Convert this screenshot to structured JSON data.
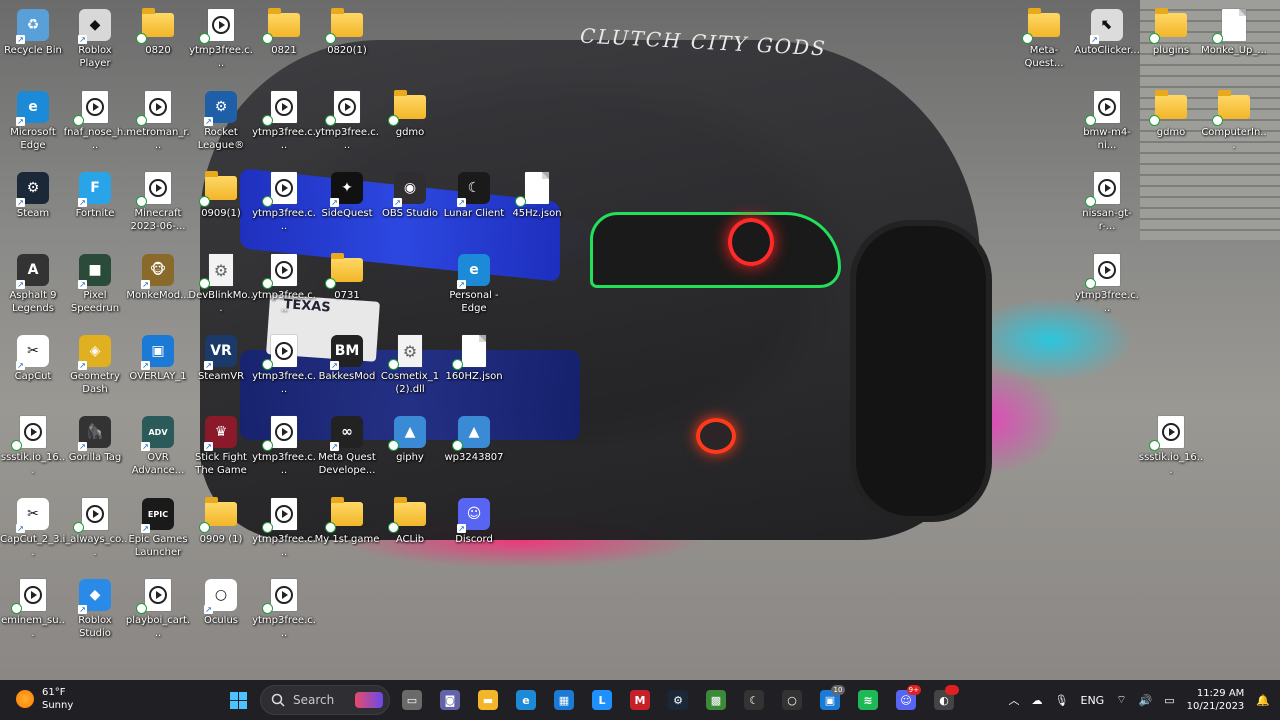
{
  "wallpaper": {
    "windshield_text": "CLUTCH CITY GODS",
    "plate_text": "TEXAS"
  },
  "desktop_icons": [
    {
      "id": "recycle-bin",
      "label": "Recycle Bin",
      "kind": "app",
      "icon": "recycle-bin-icon",
      "color": "#5aa0d8",
      "glyph": "♻"
    },
    {
      "id": "roblox-player",
      "label": "Roblox Player",
      "kind": "app",
      "icon": "roblox-icon",
      "color": "#d8d8d8",
      "glyph": "◆"
    },
    {
      "id": "folder-0820",
      "label": "0820",
      "kind": "folder",
      "icon": "folder-icon"
    },
    {
      "id": "ytmp3-1",
      "label": "ytmp3free.c...",
      "kind": "video",
      "icon": "video-file-icon"
    },
    {
      "id": "folder-0821",
      "label": "0821",
      "kind": "folder",
      "icon": "folder-icon"
    },
    {
      "id": "folder-0820-1",
      "label": "0820(1)",
      "kind": "folder",
      "icon": "folder-icon"
    },
    {
      "id": "edge",
      "label": "Microsoft Edge",
      "kind": "app",
      "icon": "edge-icon",
      "color": "#1c8ad6",
      "glyph": "e"
    },
    {
      "id": "fnaf",
      "label": "fnaf_nose_h...",
      "kind": "video",
      "icon": "video-file-icon"
    },
    {
      "id": "metroman",
      "label": "metroman_r...",
      "kind": "video",
      "icon": "video-file-icon"
    },
    {
      "id": "rocket-league",
      "label": "Rocket League®",
      "kind": "app",
      "icon": "rocket-league-icon",
      "color": "#1e5fa8",
      "glyph": "⚙"
    },
    {
      "id": "ytmp3-2",
      "label": "ytmp3free.c...",
      "kind": "video",
      "icon": "video-file-icon"
    },
    {
      "id": "ytmp3-3",
      "label": "ytmp3free.c...",
      "kind": "video",
      "icon": "video-file-icon"
    },
    {
      "id": "gdmo-1",
      "label": "gdmo",
      "kind": "folder",
      "icon": "folder-icon"
    },
    {
      "id": "steam",
      "label": "Steam",
      "kind": "app",
      "icon": "steam-icon",
      "color": "#1b2838",
      "glyph": "⚙"
    },
    {
      "id": "fortnite",
      "label": "Fortnite",
      "kind": "app",
      "icon": "fortnite-icon",
      "color": "#2aa4e8",
      "glyph": "F"
    },
    {
      "id": "minecraft-video",
      "label": "Minecraft 2023-06-...",
      "kind": "video",
      "icon": "video-file-icon"
    },
    {
      "id": "folder-0909-1b",
      "label": "0909(1)",
      "kind": "folder",
      "icon": "folder-icon"
    },
    {
      "id": "ytmp3-4",
      "label": "ytmp3free.c...",
      "kind": "video",
      "icon": "video-file-icon"
    },
    {
      "id": "sidequest",
      "label": "SideQuest",
      "kind": "app",
      "icon": "sidequest-icon",
      "color": "#111111",
      "glyph": "✦"
    },
    {
      "id": "obs",
      "label": "OBS Studio",
      "kind": "app",
      "icon": "obs-icon",
      "color": "#302e31",
      "glyph": "◉"
    },
    {
      "id": "lunar",
      "label": "Lunar Client",
      "kind": "app",
      "icon": "lunar-client-icon",
      "color": "#1a1a1a",
      "glyph": "☾"
    },
    {
      "id": "45hz",
      "label": "45Hz.json",
      "kind": "file",
      "icon": "json-file-icon"
    },
    {
      "id": "asphalt",
      "label": "Asphalt 9 Legends",
      "kind": "app",
      "icon": "asphalt-icon",
      "color": "#333333",
      "glyph": "A"
    },
    {
      "id": "pixel-speedrun",
      "label": "Pixel Speedrun",
      "kind": "app",
      "icon": "pixel-speedrun-icon",
      "color": "#2a4a3a",
      "glyph": "■"
    },
    {
      "id": "monkemod",
      "label": "MonkeMod...",
      "kind": "app",
      "icon": "monkemod-icon",
      "color": "#8a6a2a",
      "glyph": "🐵"
    },
    {
      "id": "devblink",
      "label": "DevBlinkMo...",
      "kind": "dll",
      "icon": "settings-file-icon"
    },
    {
      "id": "ytmp3-5",
      "label": "ytmp3free.c...",
      "kind": "video",
      "icon": "video-file-icon"
    },
    {
      "id": "folder-0731",
      "label": "0731",
      "kind": "folder",
      "icon": "folder-icon"
    },
    {
      "id": "personal-edge",
      "label": "Personal - Edge",
      "kind": "app",
      "icon": "edge-icon",
      "color": "#1c8ad6",
      "glyph": "e"
    },
    {
      "id": "capcut",
      "label": "CapCut",
      "kind": "app",
      "icon": "capcut-icon",
      "color": "#ffffff",
      "glyph": "✂"
    },
    {
      "id": "geometry-dash",
      "label": "Geometry Dash",
      "kind": "app",
      "icon": "geometry-dash-icon",
      "color": "#e0b020",
      "glyph": "◈"
    },
    {
      "id": "overlay",
      "label": "OVERLAY_1",
      "kind": "app",
      "icon": "overlay-icon",
      "color": "#1a7ad6",
      "glyph": "▣"
    },
    {
      "id": "steamvr",
      "label": "SteamVR",
      "kind": "app",
      "icon": "steamvr-icon",
      "color": "#1b3a6a",
      "glyph": "VR"
    },
    {
      "id": "ytmp3-6",
      "label": "ytmp3free.c...",
      "kind": "video",
      "icon": "video-file-icon"
    },
    {
      "id": "bakkesmod",
      "label": "BakkesMod",
      "kind": "app",
      "icon": "bakkesmod-icon",
      "color": "#222222",
      "glyph": "BM"
    },
    {
      "id": "cosmetix",
      "label": "Cosmetix_1 (2).dll",
      "kind": "dll",
      "icon": "dll-file-icon"
    },
    {
      "id": "160hz",
      "label": "160HZ.json",
      "kind": "file",
      "icon": "json-file-icon"
    },
    {
      "id": "ssstik-1",
      "label": "ssstik.io_16...",
      "kind": "video",
      "icon": "video-file-icon"
    },
    {
      "id": "gorilla-tag",
      "label": "Gorilla Tag",
      "kind": "app",
      "icon": "gorilla-tag-icon",
      "color": "#333333",
      "glyph": "🦍"
    },
    {
      "id": "ovr-advanced",
      "label": "OVR Advance...",
      "kind": "app",
      "icon": "ovr-advanced-icon",
      "color": "#2a5a5a",
      "glyph": "ADV"
    },
    {
      "id": "stick-fight",
      "label": "Stick Fight The Game",
      "kind": "app",
      "icon": "stick-fight-icon",
      "color": "#8a1a2a",
      "glyph": "♛"
    },
    {
      "id": "ytmp3-7",
      "label": "ytmp3free.c...",
      "kind": "video",
      "icon": "video-file-icon"
    },
    {
      "id": "meta-dev",
      "label": "Meta Quest Develope...",
      "kind": "app",
      "icon": "meta-icon",
      "color": "#222222",
      "glyph": "∞"
    },
    {
      "id": "giphy",
      "label": "giphy",
      "kind": "image",
      "icon": "image-file-icon",
      "color": "#3a8ad6",
      "glyph": "▲"
    },
    {
      "id": "wp3243807",
      "label": "wp3243807",
      "kind": "image",
      "icon": "image-file-icon",
      "color": "#3a8ad6",
      "glyph": "▲"
    },
    {
      "id": "capcut-2",
      "label": "CapCut_2_3...",
      "kind": "app",
      "icon": "capcut-icon",
      "color": "#ffffff",
      "glyph": "✂"
    },
    {
      "id": "i-always",
      "label": "i_always_co...",
      "kind": "video",
      "icon": "video-file-icon"
    },
    {
      "id": "epic",
      "label": "Epic Games Launcher",
      "kind": "app",
      "icon": "epic-games-icon",
      "color": "#1a1a1a",
      "glyph": "EPIC"
    },
    {
      "id": "folder-0909-1",
      "label": "0909 (1)",
      "kind": "folder",
      "icon": "folder-icon"
    },
    {
      "id": "ytmp3-8",
      "label": "ytmp3free.c...",
      "kind": "video",
      "icon": "video-file-icon"
    },
    {
      "id": "my-1st-game",
      "label": "My 1st game",
      "kind": "folder",
      "icon": "folder-icon"
    },
    {
      "id": "aclib",
      "label": "ACLib",
      "kind": "folder",
      "icon": "folder-icon"
    },
    {
      "id": "discord",
      "label": "Discord",
      "kind": "app",
      "icon": "discord-icon",
      "color": "#5865f2",
      "glyph": "☺"
    },
    {
      "id": "eminem",
      "label": "eminem_su...",
      "kind": "video",
      "icon": "video-file-icon"
    },
    {
      "id": "roblox-studio",
      "label": "Roblox Studio",
      "kind": "app",
      "icon": "roblox-studio-icon",
      "color": "#2a8ae8",
      "glyph": "◆"
    },
    {
      "id": "playboi",
      "label": "playboi_cart...",
      "kind": "video",
      "icon": "video-file-icon"
    },
    {
      "id": "oculus",
      "label": "Oculus",
      "kind": "app",
      "icon": "oculus-icon",
      "color": "#ffffff",
      "glyph": "○"
    },
    {
      "id": "ytmp3-9",
      "label": "ytmp3free.c...",
      "kind": "video",
      "icon": "video-file-icon"
    },
    {
      "id": "meta-quest-folder",
      "label": "Meta-Quest...",
      "kind": "folder",
      "icon": "folder-icon"
    },
    {
      "id": "autoclicker",
      "label": "AutoClicker...",
      "kind": "app",
      "icon": "autoclicker-icon",
      "color": "#dcdcdc",
      "glyph": "⬉"
    },
    {
      "id": "plugins",
      "label": "plugins",
      "kind": "folder",
      "icon": "folder-icon"
    },
    {
      "id": "monke-up",
      "label": "Monke_Up_...",
      "kind": "file",
      "icon": "file-icon"
    },
    {
      "id": "bmw",
      "label": "bmw-m4-ni...",
      "kind": "video",
      "icon": "video-file-icon"
    },
    {
      "id": "gdmo-2",
      "label": "gdmo",
      "kind": "folder",
      "icon": "folder-icon"
    },
    {
      "id": "computerin",
      "label": "ComputerIn...",
      "kind": "folder",
      "icon": "folder-icon"
    },
    {
      "id": "nissan",
      "label": "nissan-gt-r-...",
      "kind": "video",
      "icon": "video-file-icon"
    },
    {
      "id": "ytmp3-10",
      "label": "ytmp3free.c...",
      "kind": "video",
      "icon": "video-file-icon"
    },
    {
      "id": "ssstik-2",
      "label": "ssstik.io_16...",
      "kind": "video",
      "icon": "video-file-icon"
    }
  ],
  "taskbar": {
    "weather": {
      "temp": "61°F",
      "condition": "Sunny"
    },
    "search_label": "Search",
    "apps": [
      {
        "name": "task-view-button",
        "color": "#6a6a6a",
        "glyph": "▭"
      },
      {
        "name": "chat-button",
        "color": "#6264a7",
        "glyph": "◙"
      },
      {
        "name": "file-explorer-button",
        "color": "#f2b628",
        "glyph": "▬"
      },
      {
        "name": "edge-taskbar-button",
        "color": "#1c8ad6",
        "glyph": "e"
      },
      {
        "name": "microsoft-store-button",
        "color": "#1a7ad6",
        "glyph": "▦"
      },
      {
        "name": "lunar-app-button",
        "color": "#1e90ff",
        "glyph": "L"
      },
      {
        "name": "mcafee-button",
        "color": "#c8202a",
        "glyph": "M"
      },
      {
        "name": "steam-taskbar-button",
        "color": "#1b2838",
        "glyph": "⚙"
      },
      {
        "name": "minecraft-taskbar-button",
        "color": "#3a8a3a",
        "glyph": "▩"
      },
      {
        "name": "lunar-client-taskbar-button",
        "color": "#333333",
        "glyph": "☾"
      },
      {
        "name": "oculus-taskbar-button",
        "color": "#333333",
        "glyph": "○"
      },
      {
        "name": "windows-taskbar-app-button",
        "color": "#1a7ad6",
        "glyph": "▣",
        "badge": "10",
        "badge_gray": true
      },
      {
        "name": "spotify-button",
        "color": "#1db954",
        "glyph": "≋"
      },
      {
        "name": "discord-taskbar-button",
        "color": "#5865f2",
        "glyph": "☺",
        "badge": "9+"
      },
      {
        "name": "unknown-app-button",
        "color": "#444444",
        "glyph": "◐",
        "badge": " "
      }
    ],
    "tray": {
      "language": "ENG",
      "time": "11:29 AM",
      "date": "10/21/2023"
    }
  },
  "colors": {
    "taskbar_bg": "#202024",
    "folder_yellow": "#f2b628",
    "accent_blue": "#4cc2ff"
  }
}
